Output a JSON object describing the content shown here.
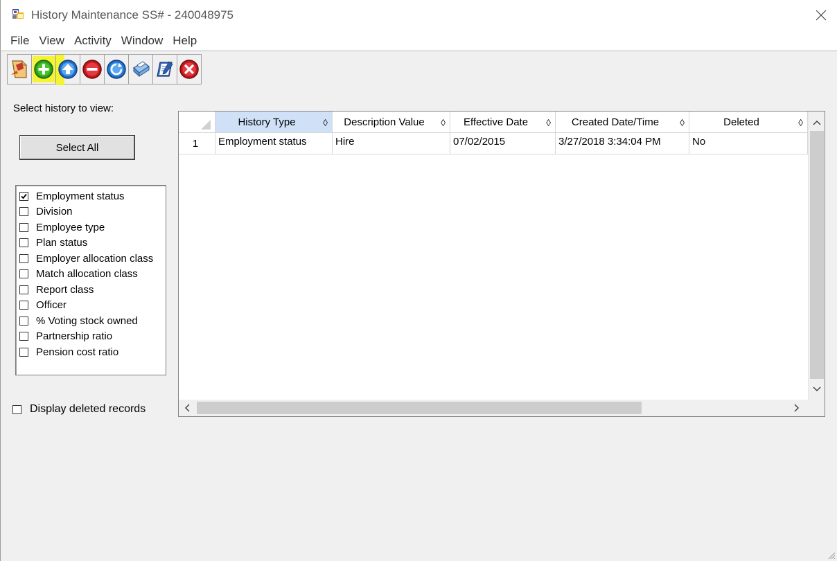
{
  "window": {
    "title": "History Maintenance SS# - 240048975"
  },
  "menu": {
    "items": [
      "File",
      "View",
      "Activity",
      "Window",
      "Help"
    ]
  },
  "toolbar": {
    "buttons": [
      "open-record-icon",
      "add-icon",
      "upload-icon",
      "remove-icon",
      "refresh-icon",
      "print-icon",
      "notes-icon",
      "exit-icon"
    ],
    "highlight_color": "#f4f41f"
  },
  "left_panel": {
    "select_label": "Select history to view:",
    "select_all_label": "Select All",
    "history_types": [
      {
        "label": "Employment status",
        "checked": true
      },
      {
        "label": "Division",
        "checked": false
      },
      {
        "label": "Employee type",
        "checked": false
      },
      {
        "label": "Plan status",
        "checked": false
      },
      {
        "label": "Employer allocation class",
        "checked": false
      },
      {
        "label": "Match allocation class",
        "checked": false
      },
      {
        "label": "Report class",
        "checked": false
      },
      {
        "label": "Officer",
        "checked": false
      },
      {
        "label": "% Voting stock owned",
        "checked": false
      },
      {
        "label": "Partnership ratio",
        "checked": false
      },
      {
        "label": "Pension cost ratio",
        "checked": false
      }
    ],
    "display_deleted_label": "Display deleted records",
    "display_deleted_checked": false
  },
  "grid": {
    "columns": [
      "History Type",
      "Description Value",
      "Effective Date",
      "Created Date/Time",
      "Deleted"
    ],
    "sort_glyph": "◊",
    "rows": [
      {
        "num": "1",
        "cells": [
          "Employment status",
          "Hire",
          "07/02/2015",
          "3/27/2018 3:34:04 PM",
          "No"
        ]
      }
    ]
  }
}
